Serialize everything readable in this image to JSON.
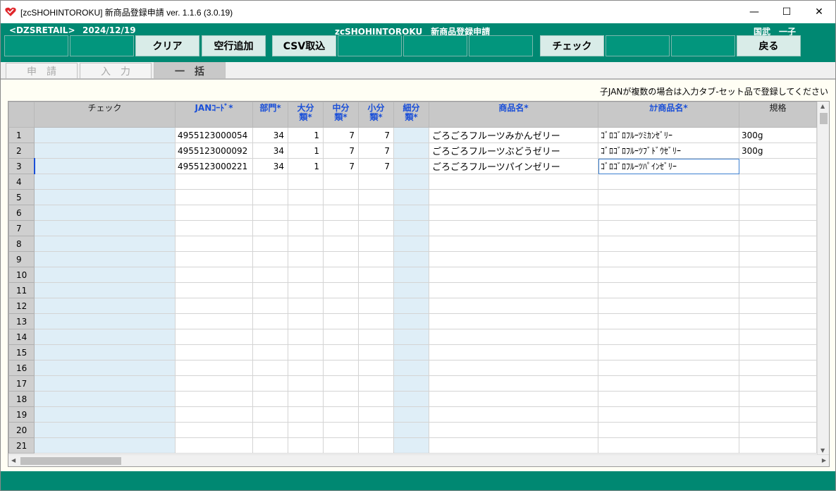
{
  "window": {
    "title": "[zcSHOHINTOROKU] 新商品登録申請 ver. 1.1.6 (3.0.19)",
    "min": "—",
    "max": "☐",
    "close": "✕"
  },
  "header": {
    "store": "<DZSRETAIL>",
    "date": "2024/12/19",
    "app_name": "zcSHOHINTOROKU　新商品登録申請",
    "user": "国武　一子"
  },
  "toolbar": {
    "clear": "クリア",
    "add_row": "空行追加",
    "csv": "CSV取込",
    "check": "チェック",
    "back": "戻る"
  },
  "tabs": [
    {
      "label": "申請"
    },
    {
      "label": "入力"
    },
    {
      "label": "一括"
    }
  ],
  "note": "子JANが複数の場合は入力タブ-セット品で登録してください",
  "columns": {
    "check": "チェック",
    "jan": "JANｺｰﾄﾞ*",
    "bumon": "部門*",
    "dai": "大分類*",
    "chu": "中分類*",
    "sho": "小分類*",
    "sai": "細分類*",
    "name": "商品名*",
    "kana": "ｶﾅ商品名*",
    "kikaku": "規格"
  },
  "rows": [
    {
      "no": "1",
      "jan": "4955123000054",
      "bumon": "34",
      "dai": "1",
      "chu": "7",
      "sho": "7",
      "name": "ごろごろフルーツみかんゼリー",
      "kana": "ｺﾞﾛｺﾞﾛﾌﾙｰﾂﾐｶﾝｾﾞﾘｰ",
      "kikaku": "300g"
    },
    {
      "no": "2",
      "jan": "4955123000092",
      "bumon": "34",
      "dai": "1",
      "chu": "7",
      "sho": "7",
      "name": "ごろごろフルーツぶどうゼリー",
      "kana": "ｺﾞﾛｺﾞﾛﾌﾙｰﾂﾌﾞﾄﾞｳｾﾞﾘｰ",
      "kikaku": "300g"
    },
    {
      "no": "3",
      "jan": "4955123000221",
      "bumon": "34",
      "dai": "1",
      "chu": "7",
      "sho": "7",
      "name": "ごろごろフルーツパインゼリー",
      "kana": "ｺﾞﾛｺﾞﾛﾌﾙｰﾂﾊﾟｲﾝｾﾞﾘｰ",
      "kikaku": ""
    },
    {
      "no": "4"
    },
    {
      "no": "5"
    },
    {
      "no": "6"
    },
    {
      "no": "7"
    },
    {
      "no": "8"
    },
    {
      "no": "9"
    },
    {
      "no": "10"
    },
    {
      "no": "11"
    },
    {
      "no": "12"
    },
    {
      "no": "13"
    },
    {
      "no": "14"
    },
    {
      "no": "15"
    },
    {
      "no": "16"
    },
    {
      "no": "17"
    },
    {
      "no": "18"
    },
    {
      "no": "19"
    },
    {
      "no": "20"
    },
    {
      "no": "21"
    }
  ],
  "colors": {
    "teal": "#008872",
    "header_blue": "#1a4fd8",
    "check_col": "#dfeef7"
  },
  "icons": {
    "app": "heart-logo-icon",
    "scroll_up": "scroll-up-arrow-icon",
    "scroll_down": "scroll-down-arrow-icon",
    "scroll_left": "scroll-left-arrow-icon",
    "scroll_right": "scroll-right-arrow-icon"
  }
}
